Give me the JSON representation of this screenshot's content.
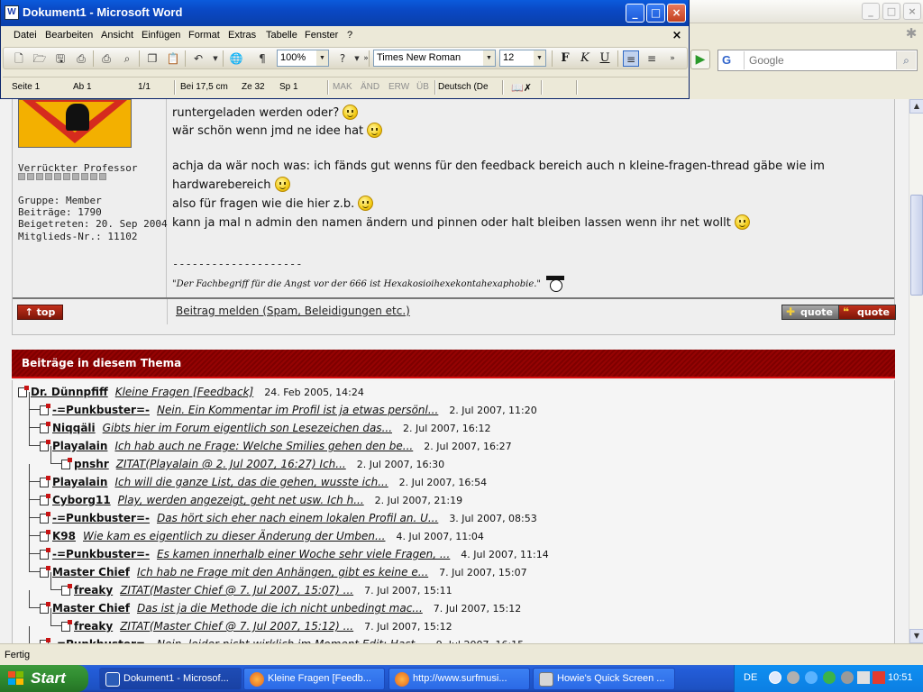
{
  "browser": {
    "search": {
      "engine": "G",
      "placeholder": "Google"
    },
    "status": "Fertig"
  },
  "word": {
    "title": "Dokument1 - Microsoft Word",
    "app_icon": "W",
    "menus": [
      "Datei",
      "Bearbeiten",
      "Ansicht",
      "Einfügen",
      "Format",
      "Extras",
      "Tabelle",
      "Fenster",
      "?"
    ],
    "toolbar": {
      "zoom": "100%",
      "font": "Times New Roman",
      "size": "12",
      "bold": "F",
      "italic": "K",
      "underline": "U"
    },
    "status": {
      "page": "Seite  1",
      "section": "Ab  1",
      "pages": "1/1",
      "at": "Bei  17,5 cm",
      "line": "Ze  32",
      "col": "Sp  1",
      "mak": "MAK",
      "and": "ÄND",
      "erw": "ERW",
      "ub": "ÜB",
      "lang": "Deutsch (De"
    }
  },
  "post": {
    "author": {
      "rank": "Verrückter Professor",
      "group": "Gruppe: Member",
      "posts": "Beiträge: 1790",
      "joined": "Beigetreten: 20. Sep 2004",
      "member_no": "Mitglieds-Nr.: 11102"
    },
    "lines": {
      "l1": "runtergeladen werden oder?",
      "l2": "wär schön wenn jmd ne idee hat",
      "l3": "achja da wär noch was: ich fänds gut wenns für den feedback bereich auch n kleine-fragen-thread gäbe wie im",
      "l4": "hardwarebereich",
      "l5": "also für fragen wie die hier z.b.",
      "l6": "kann ja mal n admin den namen ändern und pinnen oder halt bleiben lassen wenn ihr net wollt"
    },
    "signature_sep": "--------------------",
    "signature": "\"Der Fachbegriff für die Angst vor der 666 ist Hexakosioihexekontahexaphobie.\"",
    "top_label": "top",
    "report_label": "Beitrag melden (Spam, Beleidigungen etc.)",
    "multiquote_label": "quote",
    "quote_label": "quote"
  },
  "thread": {
    "header": "Beiträge in diesem Thema",
    "rows": [
      {
        "author": "Dr. Dünnpfiff",
        "title": "Kleine Fragen [Feedback]",
        "date": "24. Feb 2005, 14:24"
      },
      {
        "author": "-=Punkbuster=-",
        "title": "Nein. Ein Kommentar im Profil ist ja etwas persönl...",
        "date": "2. Jul 2007, 11:20"
      },
      {
        "author": "Niqqäli",
        "title": "Gibts hier im Forum eigentlich son Lesezeichen das...",
        "date": "2. Jul 2007, 16:12"
      },
      {
        "author": "Playalain",
        "title": "Ich hab auch ne Frage: Welche Smilies gehen den be...",
        "date": "2. Jul 2007, 16:27"
      },
      {
        "author": "pnshr",
        "title": "ZITAT(Playalain @ 2. Jul 2007, 16:27) Ich...",
        "date": "2. Jul 2007, 16:30"
      },
      {
        "author": "Playalain",
        "title": "Ich will die ganze List, das die gehen, wusste ich...",
        "date": "2. Jul 2007, 16:54"
      },
      {
        "author": "Cyborg11",
        "title": "Play, werden angezeigt, geht net usw. Ich h...",
        "date": "2. Jul 2007, 21:19"
      },
      {
        "author": "-=Punkbuster=-",
        "title": "Das hört sich eher nach einem lokalen Profil an. U...",
        "date": "3. Jul 2007, 08:53"
      },
      {
        "author": "K98",
        "title": "Wie kam es eigentlich zu dieser Änderung der Umben...",
        "date": "4. Jul 2007, 11:04"
      },
      {
        "author": "-=Punkbuster=-",
        "title": "Es kamen innerhalb einer Woche sehr viele Fragen, ...",
        "date": "4. Jul 2007, 11:14"
      },
      {
        "author": "Master Chief",
        "title": "Ich hab ne Frage mit den Anhängen, gibt es keine e...",
        "date": "7. Jul 2007, 15:07"
      },
      {
        "author": "freaky",
        "title": "ZITAT(Master Chief @ 7. Jul 2007, 15:07) ...",
        "date": "7. Jul 2007, 15:11"
      },
      {
        "author": "Master Chief",
        "title": "Das ist ja die Methode die ich nicht unbedingt mac...",
        "date": "7. Jul 2007, 15:12"
      },
      {
        "author": "freaky",
        "title": "ZITAT(Master Chief @ 7. Jul 2007, 15:12) ...",
        "date": "7. Jul 2007, 15:12"
      },
      {
        "author": "-=Punkbuster=-",
        "title": "Nein, leider nicht wirklich im Moment Edit: Hast...",
        "date": "9. Jul 2007, 16:15"
      }
    ]
  },
  "taskbar": {
    "start": "Start",
    "tasks": [
      "Dokument1 - Microsof...",
      "Kleine Fragen [Feedb...",
      "http://www.surfmusi...",
      "Howie's Quick Screen ..."
    ],
    "lang": "DE",
    "time": "10:51"
  },
  "colors": {
    "accent_red": "#8b0000",
    "xp_blue": "#245edb",
    "start_green": "#2f8a2f"
  }
}
